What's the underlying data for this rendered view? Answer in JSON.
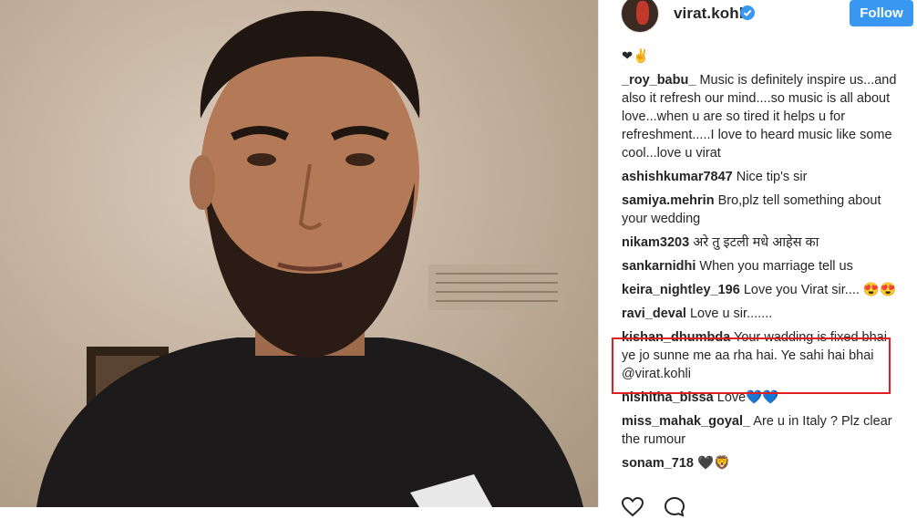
{
  "post": {
    "username": "virat.kohli",
    "follow_label": "Follow",
    "verified_color": "#3897f0",
    "accent_color": "#3897f0",
    "highlight_color": "#e02020"
  },
  "comments": [
    {
      "user": "",
      "text": "❤✌"
    },
    {
      "user": "_roy_babu_",
      "text": "Music is definitely inspire us...and also it refresh our mind....so music is all about love...when u are so tired it helps u for refreshment.....I love to heard music like some cool...love u virat"
    },
    {
      "user": "ashishkumar7847",
      "text": "Nice tip's sir"
    },
    {
      "user": "samiya.mehrin",
      "text": "Bro,plz tell something about your wedding"
    },
    {
      "user": "nikam3203",
      "text": "अरे तु इटली मधे आहेस का"
    },
    {
      "user": "sankarnidhi",
      "text": "When you marriage tell us"
    },
    {
      "user": "keira_nightley_196",
      "text": "Love you Virat sir.... 😍😍"
    },
    {
      "user": "ravi_deval",
      "text": "Love u sir......."
    },
    {
      "user": "kishan_dhumbda",
      "text": "Your wadding is fixed bhai ye jo sunne me aa rha hai. Ye sahi hai bhai @virat.kohli"
    },
    {
      "user": "nishitha_bissa",
      "text": "Love💙💙"
    },
    {
      "user": "miss_mahak_goyal_",
      "text": "Are u in Italy ? Plz clear the rumour"
    },
    {
      "user": "sonam_718",
      "text": "🖤🦁"
    }
  ],
  "icons": [
    "heart-icon",
    "comment-icon",
    "verified-badge-icon"
  ]
}
